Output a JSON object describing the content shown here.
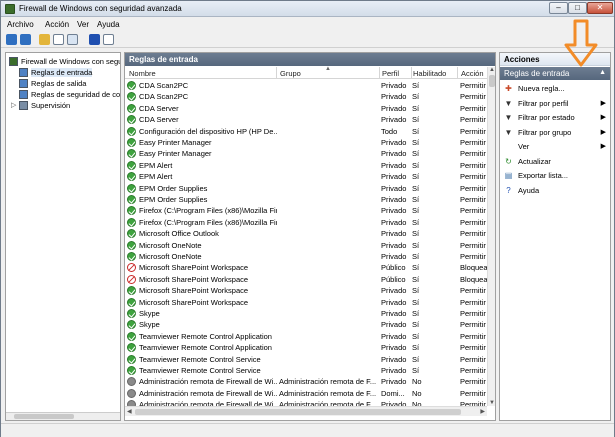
{
  "window": {
    "title": "Firewall de Windows con seguridad avanzada",
    "controls": {
      "minimize": "–",
      "maximize": "□",
      "close": "✕"
    }
  },
  "menubar": {
    "items": [
      "Archivo",
      "Acción",
      "Ver",
      "Ayuda"
    ]
  },
  "toolbar": {
    "icons": [
      "back-icon",
      "forward-icon",
      "up-folder-icon",
      "show-hide-tree-icon",
      "export-icon",
      "help-icon",
      "properties-icon"
    ]
  },
  "tree": {
    "items": [
      {
        "label": "Firewall de Windows con seguridad avanzada",
        "icon": "firewall-icon",
        "indent": 0,
        "expander": ""
      },
      {
        "label": "Reglas de entrada",
        "icon": "inbound-rules-icon",
        "indent": 1,
        "expander": "",
        "selected": true
      },
      {
        "label": "Reglas de salida",
        "icon": "outbound-rules-icon",
        "indent": 1,
        "expander": ""
      },
      {
        "label": "Reglas de seguridad de conexión",
        "icon": "connection-security-icon",
        "indent": 1,
        "expander": ""
      },
      {
        "label": "Supervisión",
        "icon": "monitoring-icon",
        "indent": 1,
        "expander": "▷"
      }
    ]
  },
  "center": {
    "header": "Reglas de entrada",
    "columns": {
      "name": "Nombre",
      "group": "Grupo",
      "profile": "Perfil",
      "enabled": "Habilitado",
      "action": "Acción"
    },
    "rows": [
      {
        "status": "allow",
        "name": "CDA Scan2PC",
        "group": "",
        "profile": "Privado",
        "enabled": "Sí",
        "action": "Permitir"
      },
      {
        "status": "allow",
        "name": "CDA Scan2PC",
        "group": "",
        "profile": "Privado",
        "enabled": "Sí",
        "action": "Permitir"
      },
      {
        "status": "allow",
        "name": "CDA Server",
        "group": "",
        "profile": "Privado",
        "enabled": "Sí",
        "action": "Permitir"
      },
      {
        "status": "allow",
        "name": "CDA Server",
        "group": "",
        "profile": "Privado",
        "enabled": "Sí",
        "action": "Permitir"
      },
      {
        "status": "allow",
        "name": "Configuración del dispositivo HP (HP De...",
        "group": "",
        "profile": "Todo",
        "enabled": "Sí",
        "action": "Permitir"
      },
      {
        "status": "allow",
        "name": "Easy Printer Manager",
        "group": "",
        "profile": "Privado",
        "enabled": "Sí",
        "action": "Permitir"
      },
      {
        "status": "allow",
        "name": "Easy Printer Manager",
        "group": "",
        "profile": "Privado",
        "enabled": "Sí",
        "action": "Permitir"
      },
      {
        "status": "allow",
        "name": "EPM Alert",
        "group": "",
        "profile": "Privado",
        "enabled": "Sí",
        "action": "Permitir"
      },
      {
        "status": "allow",
        "name": "EPM Alert",
        "group": "",
        "profile": "Privado",
        "enabled": "Sí",
        "action": "Permitir"
      },
      {
        "status": "allow",
        "name": "EPM Order Supplies",
        "group": "",
        "profile": "Privado",
        "enabled": "Sí",
        "action": "Permitir"
      },
      {
        "status": "allow",
        "name": "EPM Order Supplies",
        "group": "",
        "profile": "Privado",
        "enabled": "Sí",
        "action": "Permitir"
      },
      {
        "status": "allow",
        "name": "Firefox (C:\\Program Files (x86)\\Mozilla Fir...",
        "group": "",
        "profile": "Privado",
        "enabled": "Sí",
        "action": "Permitir"
      },
      {
        "status": "allow",
        "name": "Firefox (C:\\Program Files (x86)\\Mozilla Fir...",
        "group": "",
        "profile": "Privado",
        "enabled": "Sí",
        "action": "Permitir"
      },
      {
        "status": "allow",
        "name": "Microsoft Office Outlook",
        "group": "",
        "profile": "Privado",
        "enabled": "Sí",
        "action": "Permitir"
      },
      {
        "status": "allow",
        "name": "Microsoft OneNote",
        "group": "",
        "profile": "Privado",
        "enabled": "Sí",
        "action": "Permitir"
      },
      {
        "status": "allow",
        "name": "Microsoft OneNote",
        "group": "",
        "profile": "Privado",
        "enabled": "Sí",
        "action": "Permitir"
      },
      {
        "status": "block",
        "name": "Microsoft SharePoint Workspace",
        "group": "",
        "profile": "Público",
        "enabled": "Sí",
        "action": "Bloquear"
      },
      {
        "status": "block",
        "name": "Microsoft SharePoint Workspace",
        "group": "",
        "profile": "Público",
        "enabled": "Sí",
        "action": "Bloquear"
      },
      {
        "status": "allow",
        "name": "Microsoft SharePoint Workspace",
        "group": "",
        "profile": "Privado",
        "enabled": "Sí",
        "action": "Permitir"
      },
      {
        "status": "allow",
        "name": "Microsoft SharePoint Workspace",
        "group": "",
        "profile": "Privado",
        "enabled": "Sí",
        "action": "Permitir"
      },
      {
        "status": "allow",
        "name": "Skype",
        "group": "",
        "profile": "Privado",
        "enabled": "Sí",
        "action": "Permitir"
      },
      {
        "status": "allow",
        "name": "Skype",
        "group": "",
        "profile": "Privado",
        "enabled": "Sí",
        "action": "Permitir"
      },
      {
        "status": "allow",
        "name": "Teamviewer Remote Control Application",
        "group": "",
        "profile": "Privado",
        "enabled": "Sí",
        "action": "Permitir"
      },
      {
        "status": "allow",
        "name": "Teamviewer Remote Control Application",
        "group": "",
        "profile": "Privado",
        "enabled": "Sí",
        "action": "Permitir"
      },
      {
        "status": "allow",
        "name": "Teamviewer Remote Control Service",
        "group": "",
        "profile": "Privado",
        "enabled": "Sí",
        "action": "Permitir"
      },
      {
        "status": "allow",
        "name": "Teamviewer Remote Control Service",
        "group": "",
        "profile": "Privado",
        "enabled": "Sí",
        "action": "Permitir"
      },
      {
        "status": "disabled",
        "name": "Administración remota de Firewall de Wi...",
        "group": "Administración remota de F...",
        "profile": "Privado",
        "enabled": "No",
        "action": "Permitir"
      },
      {
        "status": "disabled",
        "name": "Administración remota de Firewall de Wi...",
        "group": "Administración remota de F...",
        "profile": "Domi...",
        "enabled": "No",
        "action": "Permitir"
      },
      {
        "status": "disabled",
        "name": "Administración remota de Firewall de Wi...",
        "group": "Administración remota de F...",
        "profile": "Privado",
        "enabled": "No",
        "action": "Permitir"
      }
    ]
  },
  "actions": {
    "header": "Acciones",
    "section": "Reglas de entrada",
    "section_caret": "▲",
    "items": [
      {
        "label": "Nueva regla...",
        "icon": "new-rule-icon",
        "glyph": "✚",
        "color": "#c94a2a",
        "submenu": ""
      },
      {
        "label": "Filtrar por perfil",
        "icon": "filter-icon",
        "glyph": "▼",
        "color": "#333333",
        "submenu": "▶"
      },
      {
        "label": "Filtrar por estado",
        "icon": "filter-icon",
        "glyph": "▼",
        "color": "#333333",
        "submenu": "▶"
      },
      {
        "label": "Filtrar por grupo",
        "icon": "filter-icon",
        "glyph": "▼",
        "color": "#333333",
        "submenu": "▶"
      },
      {
        "label": "Ver",
        "icon": "",
        "glyph": "",
        "color": "#333333",
        "submenu": "▶"
      },
      {
        "label": "Actualizar",
        "icon": "refresh-icon",
        "glyph": "↻",
        "color": "#2d8a2d",
        "submenu": ""
      },
      {
        "label": "Exportar lista...",
        "icon": "export-list-icon",
        "glyph": "▤",
        "color": "#3a6ea5",
        "submenu": ""
      },
      {
        "label": "Ayuda",
        "icon": "help-icon",
        "glyph": "?",
        "color": "#1f4fb0",
        "submenu": ""
      }
    ]
  },
  "colors": {
    "accent_arrow": "#f28c28",
    "allow": "#3ea33e",
    "block": "#c92a2a",
    "disabled": "#8a8a8a"
  }
}
